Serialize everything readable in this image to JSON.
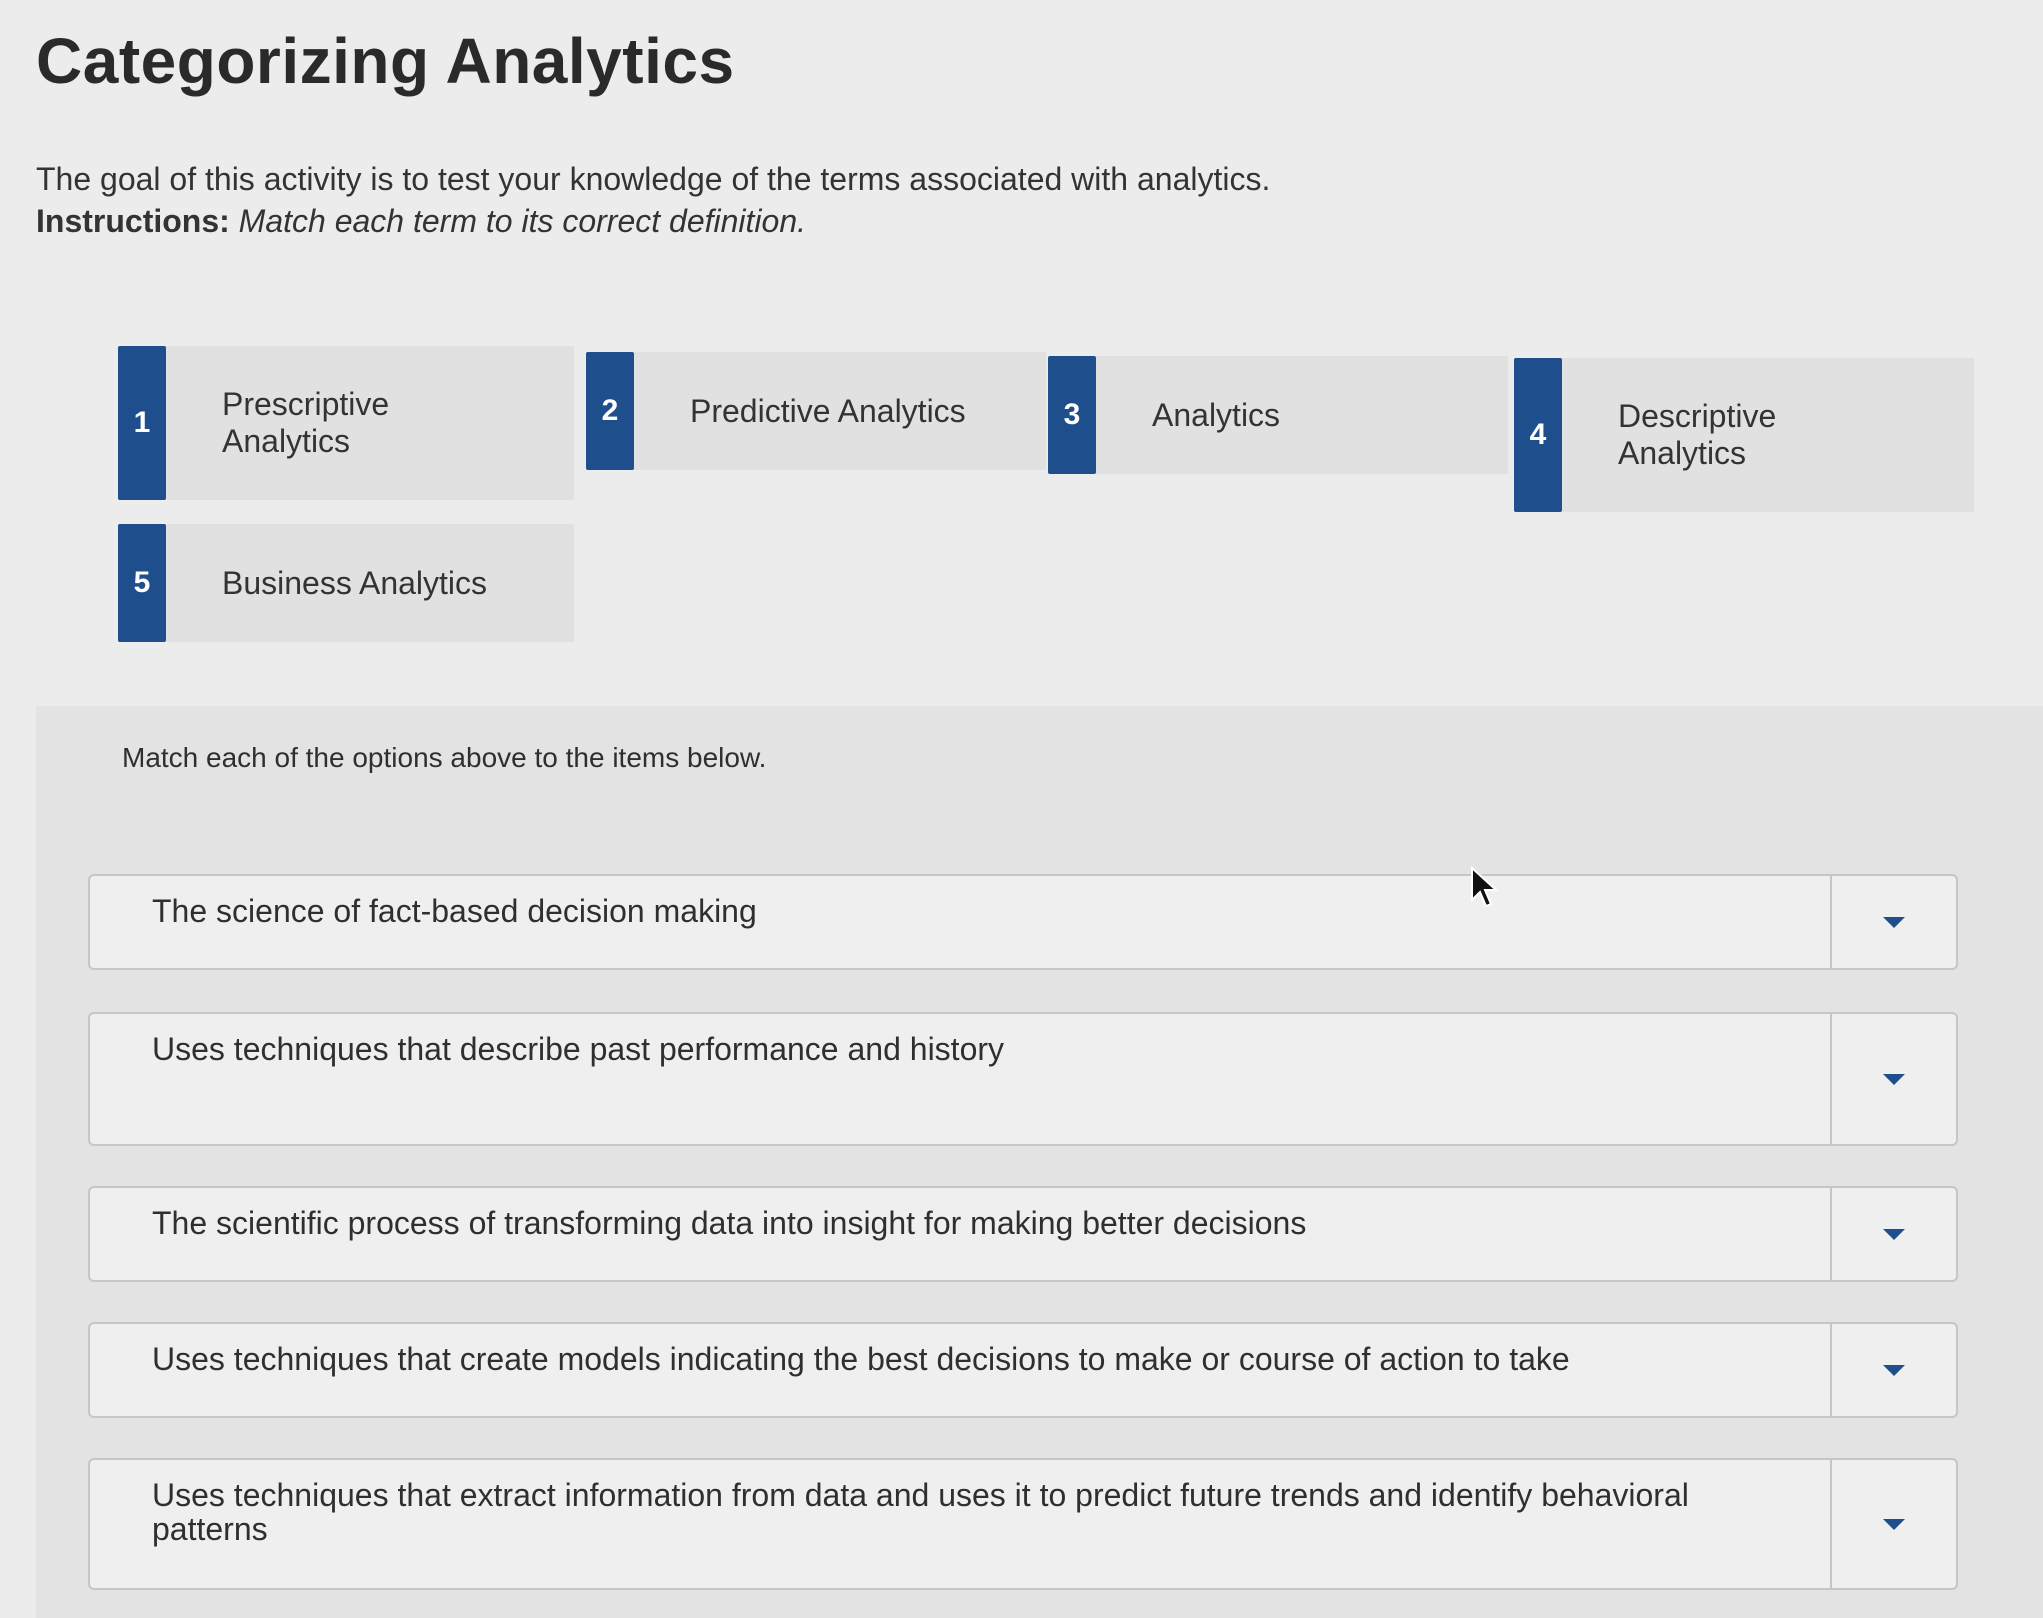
{
  "page": {
    "title": "Categorizing Analytics",
    "intro_line1": "The goal of this activity is to test your knowledge of the terms associated with analytics.",
    "instructions_label": "Instructions:",
    "instructions_text": "Match each term to its correct definition."
  },
  "terms": [
    {
      "number": "1",
      "label": "Prescriptive Analytics"
    },
    {
      "number": "2",
      "label": "Predictive Analytics"
    },
    {
      "number": "3",
      "label": "Analytics"
    },
    {
      "number": "4",
      "label": "Descriptive Analytics"
    },
    {
      "number": "5",
      "label": "Business Analytics"
    }
  ],
  "matching": {
    "instruction": "Match each of the options above to the items below.",
    "items": [
      {
        "text": "The science of fact-based decision making"
      },
      {
        "text": "Uses techniques that describe past performance and history"
      },
      {
        "text": "The scientific process of transforming data into insight for making better decisions"
      },
      {
        "text": "Uses techniques that create models indicating the best decisions to make or course of action to take"
      },
      {
        "text": "Uses techniques that extract information from data and uses it to predict future trends and identify behavioral patterns"
      }
    ]
  },
  "icons": {
    "dropdown": "chevron-down-icon",
    "cursor": "mouse-pointer-icon"
  },
  "colors": {
    "accent": "#1f4e8c",
    "card_bg": "#e1e1e1",
    "page_bg": "#ececec"
  }
}
